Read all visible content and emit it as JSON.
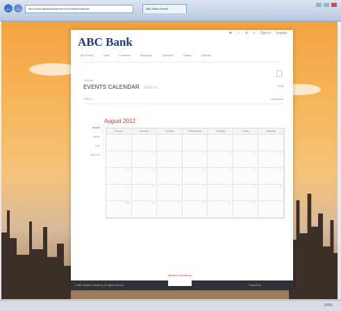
{
  "browser": {
    "url": "http://www.abcbankcalendar.com/events/calendar",
    "tab_title": "ABC Bank Events",
    "zoom": "100%"
  },
  "topbar": {
    "icons": [
      "✱",
      "⤢",
      "⚙",
      "≡"
    ],
    "signin": "Sign in",
    "language": "English"
  },
  "brand": {
    "name": "ABC Bank"
  },
  "menu": {
    "items": [
      "My Events",
      "Lists",
      "Locations",
      "Bookings",
      "Calendar",
      "Gallery",
      "Reports"
    ]
  },
  "page": {
    "crumb": "Calendar",
    "title": "EVENTS CALENDAR",
    "subtitle": "MONTH",
    "add": "+ Add",
    "filters": "Filters",
    "advanced": "Advanced"
  },
  "views": [
    "Month",
    "Week",
    "Day",
    "Agenda"
  ],
  "calendar": {
    "title": "August 2012",
    "weekdays": [
      "Sunday",
      "Monday",
      "Tuesday",
      "Wednesday",
      "Thursday",
      "Friday",
      "Saturday"
    ],
    "weeks": [
      [
        "",
        "",
        "",
        "1",
        "2",
        "3",
        "4"
      ],
      [
        "5",
        "6",
        "7",
        "8",
        "9",
        "10",
        "11"
      ],
      [
        "12",
        "13",
        "14",
        "15",
        "16",
        "17",
        "18"
      ],
      [
        "19",
        "20",
        "21",
        "22",
        "23",
        "24",
        "25"
      ],
      [
        "26",
        "27",
        "28",
        "29",
        "30",
        "31",
        ""
      ]
    ],
    "today": "26"
  },
  "footer": {
    "copyright": "© ABC Banker's Academy. All rights reserved.",
    "powered": "Powered by",
    "logo_text": "Banker's Academy"
  },
  "colors": {
    "accent": "#c0392b",
    "brand": "#1c3d7a",
    "sky_top": "#f3a341"
  }
}
